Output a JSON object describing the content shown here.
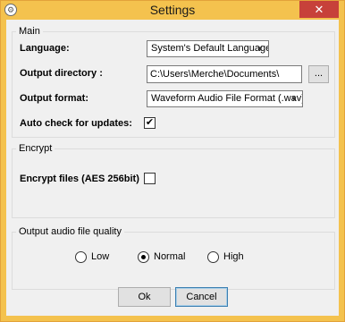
{
  "window": {
    "title": "Settings",
    "close_glyph": "✕",
    "app_icon": "gear-icon"
  },
  "main": {
    "legend": "Main",
    "language_label": "Language:",
    "language_value": "System's Default Language",
    "output_dir_label": "Output directory :",
    "output_dir_value": "C:\\Users\\Merche\\Documents\\",
    "browse_label": "...",
    "output_format_label": "Output format:",
    "output_format_value": "Waveform Audio File Format (.wav)",
    "auto_check_label": "Auto check for updates:",
    "auto_check_checked": true
  },
  "encrypt": {
    "legend": "Encrypt",
    "encrypt_label": "Encrypt files (AES 256bit)",
    "encrypt_checked": false
  },
  "quality": {
    "legend": "Output audio file quality",
    "options": [
      "Low",
      "Normal",
      "High"
    ],
    "selected": "Normal"
  },
  "buttons": {
    "ok": "Ok",
    "cancel": "Cancel"
  },
  "check_glyph": "✔",
  "dropdown_glyph": "▼"
}
